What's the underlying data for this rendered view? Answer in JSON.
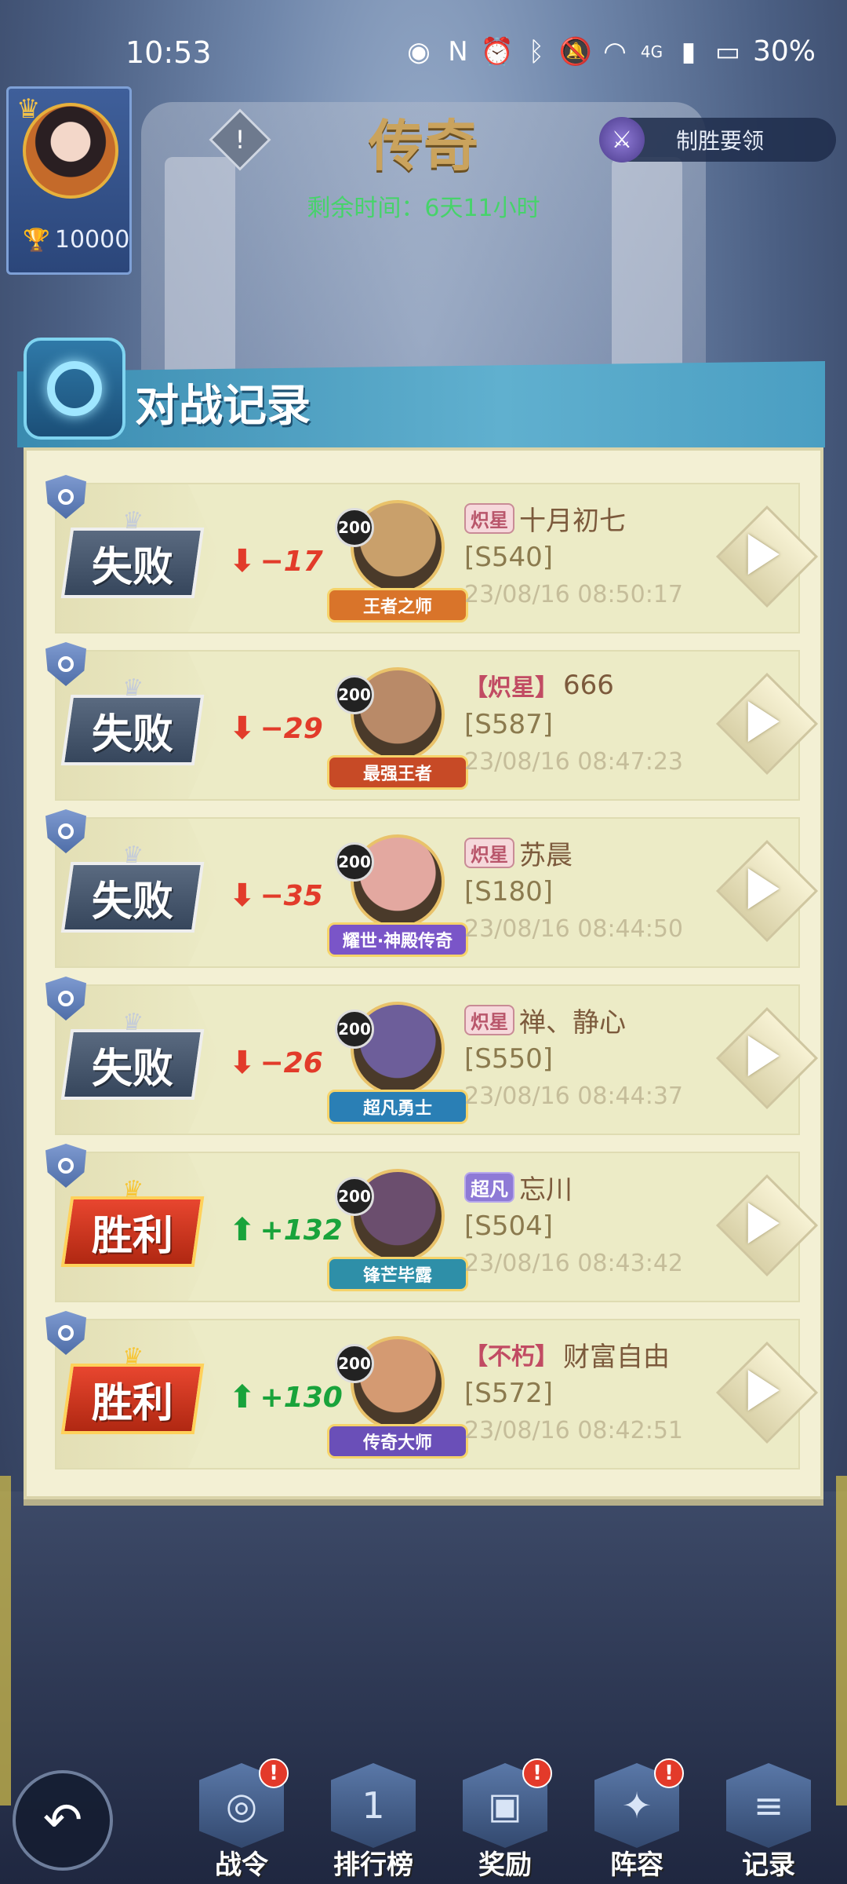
{
  "status_bar": {
    "time": "10:53",
    "icons": [
      "eye-icon",
      "nfc-icon",
      "alarm-icon",
      "bluetooth-icon",
      "mute-icon",
      "wifi-icon",
      "signal-icon",
      "battery-icon"
    ],
    "network": "4G",
    "battery": "30%"
  },
  "profile": {
    "score": "10000"
  },
  "header": {
    "title": "传奇",
    "remaining_time": "剩余时间：6天11小时",
    "tips_label": "制胜要领"
  },
  "panel": {
    "title": "对战记录"
  },
  "records": [
    {
      "result": "失败",
      "result_type": "lose",
      "delta": "−17",
      "direction": "down",
      "hero_level": "200",
      "hero_title": "王者之师",
      "hero_title_color": "#d9742a",
      "hero_face_color": "#c9a06b",
      "rank_tag": "炽星",
      "rank_style": "plain",
      "name": "十月初七",
      "server": "[S540]",
      "datetime": "23/08/16  08:50:17"
    },
    {
      "result": "失败",
      "result_type": "lose",
      "delta": "−29",
      "direction": "down",
      "hero_level": "200",
      "hero_title": "最强王者",
      "hero_title_color": "#c74a26",
      "hero_face_color": "#b98a68",
      "rank_tag": "【炽星】",
      "rank_style": "bracket",
      "name": "666",
      "server": "[S587]",
      "datetime": "23/08/16  08:47:23"
    },
    {
      "result": "失败",
      "result_type": "lose",
      "delta": "−35",
      "direction": "down",
      "hero_level": "200",
      "hero_title": "耀世·神殿传奇",
      "hero_title_color": "#7a55c8",
      "hero_face_color": "#e3a8a0",
      "rank_tag": "炽星",
      "rank_style": "plain",
      "name": "苏晨",
      "server": "[S180]",
      "datetime": "23/08/16  08:44:50"
    },
    {
      "result": "失败",
      "result_type": "lose",
      "delta": "−26",
      "direction": "down",
      "hero_level": "200",
      "hero_title": "超凡勇士",
      "hero_title_color": "#2a7fb5",
      "hero_face_color": "#6d5e9a",
      "rank_tag": "炽星",
      "rank_style": "plain",
      "name": "禅、静心",
      "server": "[S550]",
      "datetime": "23/08/16  08:44:37"
    },
    {
      "result": "胜利",
      "result_type": "win",
      "delta": "+132",
      "direction": "up",
      "hero_level": "200",
      "hero_title": "锋芒毕露",
      "hero_title_color": "#2e8fa8",
      "hero_face_color": "#6b4e6e",
      "rank_tag": "超凡",
      "rank_style": "chaofan",
      "name": "忘川",
      "server": "[S504]",
      "datetime": "23/08/16  08:43:42"
    },
    {
      "result": "胜利",
      "result_type": "win",
      "delta": "+130",
      "direction": "up",
      "hero_level": "200",
      "hero_title": "传奇大师",
      "hero_title_color": "#6a4fb8",
      "hero_face_color": "#d49a72",
      "rank_tag": "【不朽】",
      "rank_style": "bracket",
      "name": "财富自由",
      "server": "[S572]",
      "datetime": "23/08/16  08:42:51"
    }
  ],
  "nav": [
    {
      "label": "战令",
      "icon": "battle-pass-icon",
      "badge": "!"
    },
    {
      "label": "排行榜",
      "icon": "leaderboard-icon",
      "badge": ""
    },
    {
      "label": "奖励",
      "icon": "reward-icon",
      "badge": "!"
    },
    {
      "label": "阵容",
      "icon": "lineup-icon",
      "badge": "!"
    },
    {
      "label": "记录",
      "icon": "record-icon",
      "badge": ""
    }
  ]
}
